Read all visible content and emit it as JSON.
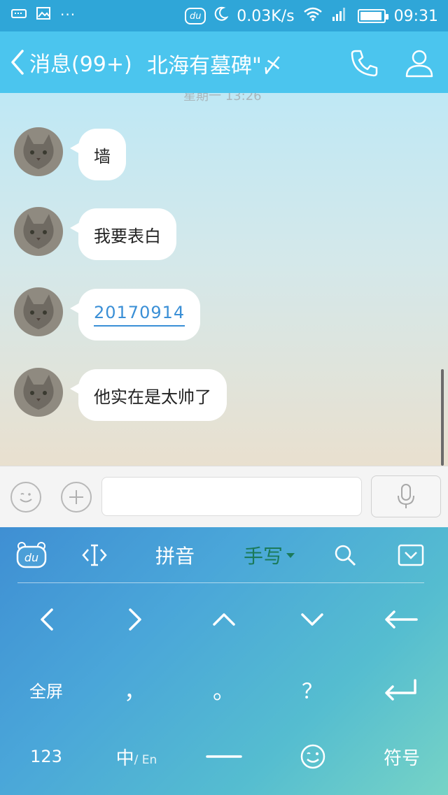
{
  "status_bar": {
    "network_speed": "0.03K/s",
    "time": "09:31",
    "du_badge": "du",
    "more": "···",
    "icons": [
      "keyboard-icon",
      "image-icon",
      "more-icon",
      "du-badge-icon",
      "moon-icon",
      "wifi-icon",
      "signal-icon",
      "battery-icon"
    ]
  },
  "header": {
    "back_label": "消息(99+)",
    "title": "北海有墓碑\"〆",
    "icons": [
      "chevron-left-icon",
      "phone-icon",
      "person-icon"
    ]
  },
  "chat": {
    "timestamp": "星期一 13:26",
    "messages": [
      {
        "text": "墙",
        "type": "text"
      },
      {
        "text": "我要表白",
        "type": "text"
      },
      {
        "text": "20170914",
        "type": "link"
      },
      {
        "text": "他实在是太帅了",
        "type": "text"
      }
    ]
  },
  "input_bar": {
    "placeholder": "",
    "icons": [
      "emoji-icon",
      "plus-icon",
      "microphone-icon"
    ]
  },
  "keyboard": {
    "toolbar": {
      "du": "du",
      "pinyin": "拼音",
      "handwrite": "手写",
      "icons": [
        "du-logo-icon",
        "cursor-icon",
        "search-icon",
        "collapse-keyboard-icon"
      ]
    },
    "row1": [
      "left-arrow-icon",
      "right-arrow-icon",
      "up-arrow-icon",
      "down-arrow-icon",
      "backspace-icon"
    ],
    "row2": {
      "fullscreen": "全屏",
      "comma": "，",
      "period": "。",
      "question": "？"
    },
    "row3": {
      "numbers": "123",
      "lang_main": "中",
      "lang_sub": "/ En",
      "symbols": "符号"
    },
    "accent_color": "#1b7a5a"
  }
}
